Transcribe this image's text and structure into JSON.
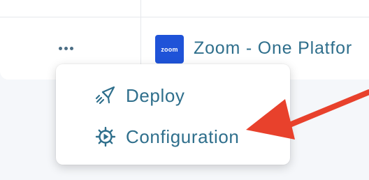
{
  "row": {
    "more_button_icon": "more-horizontal-icon",
    "app": {
      "logo_text": "zoom",
      "logo_color": "#1f53d8",
      "name": "Zoom - One Platfor"
    }
  },
  "menu": {
    "items": [
      {
        "label": "Deploy",
        "icon": "paper-plane-icon"
      },
      {
        "label": "Configuration",
        "icon": "gear-icon"
      }
    ]
  },
  "annotation": {
    "type": "arrow",
    "color": "#e8412c",
    "points_to": "Configuration"
  },
  "colors": {
    "accent_text": "#2f6f8c",
    "background": "#f5f7fa"
  }
}
